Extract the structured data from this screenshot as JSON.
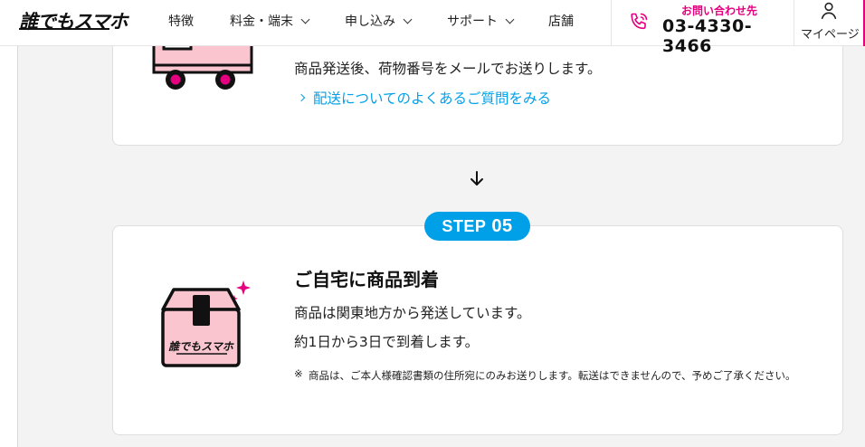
{
  "header": {
    "logo": "誰でもスマホ",
    "nav": [
      {
        "label": "特徴",
        "has_dropdown": false
      },
      {
        "label": "料金・端末",
        "has_dropdown": true
      },
      {
        "label": "申し込み",
        "has_dropdown": true
      },
      {
        "label": "サポート",
        "has_dropdown": true
      },
      {
        "label": "店舗",
        "has_dropdown": false
      }
    ],
    "contact": {
      "label": "お問い合わせ先",
      "number": "03-4330-3466",
      "icon": "phone-icon"
    },
    "mypage": {
      "label": "マイページ",
      "icon": "person-icon"
    }
  },
  "step4": {
    "text": "商品発送後、荷物番号をメールでお送りします。",
    "link": "配送についてのよくあるご質問をみる",
    "icon": "truck-icon"
  },
  "step5": {
    "badge_word": "STEP",
    "badge_num": "05",
    "title": "ご自宅に商品到着",
    "line1": "商品は関東地方から発送しています。",
    "line2": "約1日から3日で到着します。",
    "note_mark": "※",
    "note": "商品は、ご本人様確認書類の住所宛にのみお送りします。転送はできませんので、予めご了承ください。",
    "box_logo": "誰でもスマホ",
    "icon": "package-icon"
  },
  "colors": {
    "accent": "#e4007f",
    "link": "#00a0e9",
    "background": "#f3f3f3"
  }
}
